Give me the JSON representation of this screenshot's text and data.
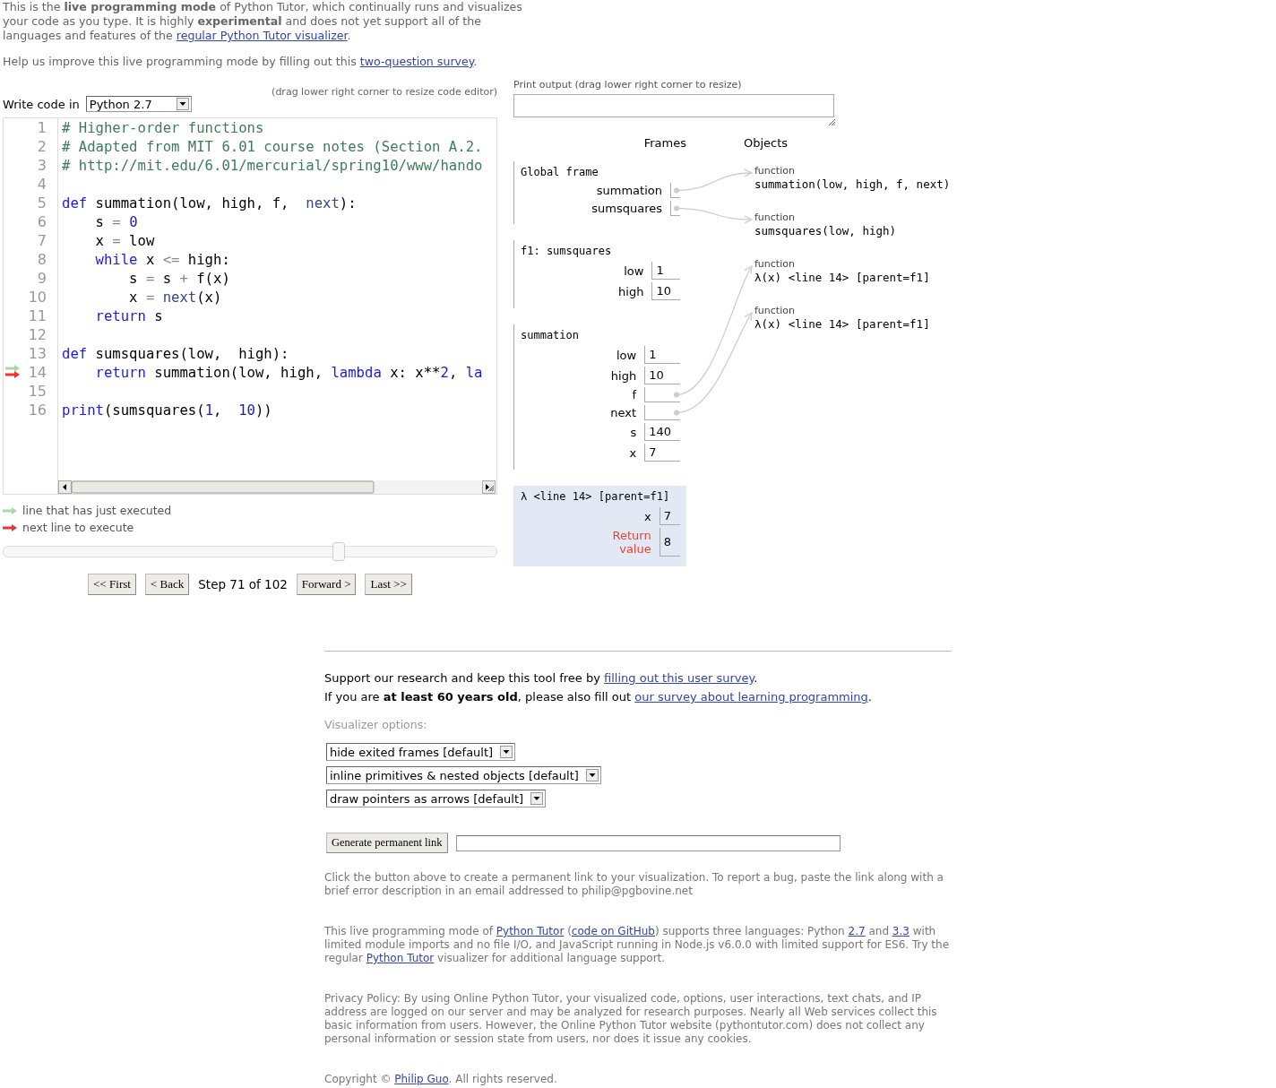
{
  "intro": [
    {
      "parts": [
        {
          "text": "This is the **live programming mode** of Python Tutor, which continually runs and visualizes your code as you type. It is highly **experimental** and does not yet support all of the languages and features of the "
        },
        {
          "link": "regular Python Tutor visualizer"
        },
        {
          "text": "."
        }
      ]
    },
    {
      "parts": [
        {
          "text": "Help us improve this live programming mode by filling out this "
        },
        {
          "link": "two-question survey"
        },
        {
          "text": "."
        }
      ]
    }
  ],
  "editor": {
    "language_label": "Write code in",
    "language": "Python 2.7",
    "resize_hint": "(drag lower right corner to resize code editor)",
    "lines": [
      {
        "number": "1",
        "executed": false,
        "next": false,
        "tokens": [
          {
            "kind": "comment",
            "text": "# Higher-order functions"
          }
        ]
      },
      {
        "number": "2",
        "executed": false,
        "next": false,
        "tokens": [
          {
            "kind": "comment",
            "text": "# Adapted from MIT 6.01 course notes (Section A.2."
          }
        ]
      },
      {
        "number": "3",
        "executed": false,
        "next": false,
        "tokens": [
          {
            "kind": "comment",
            "text": "# http://mit.edu/6.01/mercurial/spring10/www/hando"
          }
        ]
      },
      {
        "number": "4",
        "executed": false,
        "next": false
      },
      {
        "number": "5",
        "executed": false,
        "next": false,
        "tokens": [
          {
            "kind": "keyword",
            "text": "def"
          },
          {
            "kind": "plain",
            "text": " summation(low, high, f,  "
          },
          {
            "kind": "builtin",
            "text": "next"
          },
          {
            "kind": "plain",
            "text": "):"
          }
        ]
      },
      {
        "number": "6",
        "executed": false,
        "next": false,
        "tokens": [
          {
            "kind": "plain",
            "text": "    s "
          },
          {
            "kind": "operator",
            "text": "= "
          },
          {
            "kind": "number",
            "text": "0"
          }
        ]
      },
      {
        "number": "7",
        "executed": false,
        "next": false,
        "tokens": [
          {
            "kind": "plain",
            "text": "    x "
          },
          {
            "kind": "operator",
            "text": "="
          },
          {
            "kind": "plain",
            "text": " low"
          }
        ]
      },
      {
        "number": "8",
        "executed": false,
        "next": false,
        "tokens": [
          {
            "kind": "keyword",
            "text": "    while"
          },
          {
            "kind": "plain",
            "text": " x "
          },
          {
            "kind": "operator",
            "text": "<="
          },
          {
            "kind": "plain",
            "text": " high:"
          }
        ]
      },
      {
        "number": "9",
        "executed": false,
        "next": false,
        "tokens": [
          {
            "kind": "plain",
            "text": "        s "
          },
          {
            "kind": "operator",
            "text": "="
          },
          {
            "kind": "plain",
            "text": " s "
          },
          {
            "kind": "operator",
            "text": "+"
          },
          {
            "kind": "plain",
            "text": " f(x)"
          }
        ]
      },
      {
        "number": "10",
        "executed": false,
        "next": false,
        "tokens": [
          {
            "kind": "plain",
            "text": "        x "
          },
          {
            "kind": "operator",
            "text": "= "
          },
          {
            "kind": "builtin",
            "text": "next"
          },
          {
            "kind": "plain",
            "text": "(x)"
          }
        ]
      },
      {
        "number": "11",
        "executed": false,
        "next": false,
        "tokens": [
          {
            "kind": "keyword",
            "text": "    return"
          },
          {
            "kind": "plain",
            "text": " s"
          }
        ]
      },
      {
        "number": "12",
        "executed": false,
        "next": false
      },
      {
        "number": "13",
        "executed": false,
        "next": false,
        "tokens": [
          {
            "kind": "keyword",
            "text": "def"
          },
          {
            "kind": "plain",
            "text": " sumsquares(low,  high):"
          }
        ]
      },
      {
        "number": "14",
        "executed": true,
        "next": true,
        "tokens": [
          {
            "kind": "keyword",
            "text": "    return"
          },
          {
            "kind": "plain",
            "text": " summation(low, high, "
          },
          {
            "kind": "keyword",
            "text": "lambda"
          },
          {
            "kind": "plain",
            "text": " x: x**"
          },
          {
            "kind": "number",
            "text": "2"
          },
          {
            "kind": "plain",
            "text": ", "
          },
          {
            "kind": "keyword",
            "text": "la"
          }
        ]
      },
      {
        "number": "15",
        "executed": false,
        "next": false
      },
      {
        "number": "16",
        "executed": false,
        "next": false,
        "tokens": [
          {
            "kind": "keyword",
            "text": "print"
          },
          {
            "kind": "plain",
            "text": "(sumsquares("
          },
          {
            "kind": "number",
            "text": "1"
          },
          {
            "kind": "plain",
            "text": ",  "
          },
          {
            "kind": "number",
            "text": "10"
          },
          {
            "kind": "plain",
            "text": "))"
          }
        ]
      }
    ]
  },
  "legend": [
    {
      "kind": "executed",
      "text": "line that has just executed"
    },
    {
      "kind": "next",
      "text": "next line to execute"
    }
  ],
  "slider": {
    "level": 0.68
  },
  "navigation": [
    {
      "kind": "button",
      "label": "<< First"
    },
    {
      "kind": "button",
      "label": "< Back"
    },
    {
      "kind": "text",
      "label": "Step 71 of 102"
    },
    {
      "kind": "button",
      "label": "Forward >"
    },
    {
      "kind": "button",
      "label": "Last >>"
    }
  ],
  "print_output": {
    "label": "Print output (drag lower right corner to resize)"
  },
  "visualization": {
    "headers": [
      "Frames",
      "Objects"
    ],
    "frames": [
      {
        "title": "Global frame",
        "highlighted": false,
        "vars": [
          {
            "name": "summation",
            "kind": "pointer"
          },
          {
            "name": "sumsquares",
            "kind": "pointer"
          }
        ]
      },
      {
        "title": "f1: sumsquares",
        "highlighted": false,
        "vars": [
          {
            "name": "low",
            "kind": "primitive",
            "value": "1"
          },
          {
            "name": "high",
            "kind": "primitive",
            "value": "10"
          }
        ]
      },
      {
        "title": "summation",
        "highlighted": false,
        "vars": [
          {
            "name": "low",
            "kind": "primitive",
            "value": "1"
          },
          {
            "name": "high",
            "kind": "primitive",
            "value": "10"
          },
          {
            "name": "f",
            "kind": "pointer"
          },
          {
            "name": "next",
            "kind": "pointer"
          },
          {
            "name": "s",
            "kind": "primitive",
            "value": "140"
          },
          {
            "name": "x",
            "kind": "primitive",
            "value": "7"
          }
        ]
      },
      {
        "title": "λ <line 14> [parent=f1]",
        "highlighted": true,
        "vars": [
          {
            "name": "x",
            "kind": "primitive",
            "value": "7"
          },
          {
            "name": "Return value",
            "kind": "return",
            "value": "8"
          }
        ]
      }
    ],
    "objects": [
      {
        "type": "function",
        "label": "summation(low, high, f, next)"
      },
      {
        "type": "function",
        "label": "sumsquares(low, high)"
      },
      {
        "type": "function",
        "label": "λ(x) <line 14> [parent=f1]"
      },
      {
        "type": "function",
        "label": "λ(x) <line 14> [parent=f1]"
      }
    ]
  },
  "footer": {
    "support": [
      {
        "parts": [
          {
            "text": "Support our research and keep this tool free by "
          },
          {
            "link": "filling out this user survey"
          },
          {
            "text": "."
          }
        ]
      },
      {
        "parts": [
          {
            "text": "If you are **at least 60 years old**, please also fill out "
          },
          {
            "link": "our survey about learning programming"
          },
          {
            "text": "."
          }
        ]
      }
    ],
    "options_label": "Visualizer options:",
    "options": [
      "hide exited frames [default]",
      "inline primitives & nested objects [default]",
      "draw pointers as arrows [default]"
    ],
    "permalink_button": "Generate permanent link",
    "notes": [
      {
        "parts": [
          {
            "text": "Click the button above to create a permanent link to your visualization. To report a bug, paste the link along with a brief error description in an email addressed to philip@pgbovine.net"
          }
        ]
      },
      {
        "parts": [
          {
            "text": "This live programming mode of "
          },
          {
            "link": "Python Tutor"
          },
          {
            "text": " ("
          },
          {
            "link": "code on GitHub"
          },
          {
            "text": ") supports three languages: Python "
          },
          {
            "link": "2.7"
          },
          {
            "text": " and "
          },
          {
            "link": "3.3"
          },
          {
            "text": " with limited module imports and no file I/O, and JavaScript running in Node.js v6.0.0 with limited support for ES6. Try the regular "
          },
          {
            "link": "Python Tutor"
          },
          {
            "text": " visualizer for additional language support."
          }
        ]
      },
      {
        "parts": [
          {
            "text": "Privacy Policy: By using Online Python Tutor, your visualized code, options, user interactions, text chats, and IP address are logged on our server and may be analyzed for research purposes. Nearly all Web services collect this basic information from users. However, the Online Python Tutor website (pythontutor.com) does not collect any personal information or session state from users, nor does it issue any cookies."
          }
        ]
      },
      {
        "parts": [
          {
            "text": "Copyright © "
          },
          {
            "link": "Philip Guo"
          },
          {
            "text": ". All rights reserved."
          }
        ]
      }
    ]
  }
}
